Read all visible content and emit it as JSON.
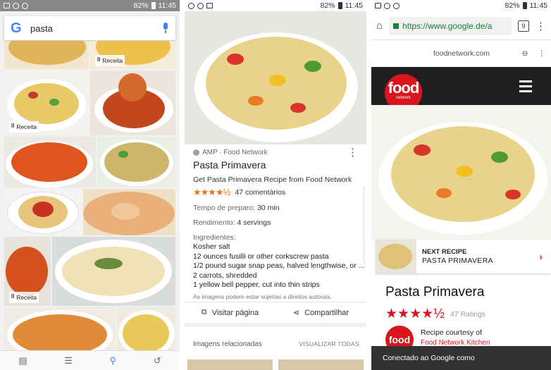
{
  "status": {
    "battery": "82%",
    "time": "11:45"
  },
  "panel1": {
    "google_logo": "G",
    "query": "pasta",
    "badges": {
      "receita": "Receita"
    },
    "nav_icons": [
      "feed-icon",
      "updates-icon",
      "search-icon",
      "history-icon"
    ]
  },
  "panel2": {
    "source": "AMP · Food Network",
    "title": "Pasta Primavera",
    "subtitle": "Get Pasta Primavera Recipe from Food Network",
    "stars": "★★★★½",
    "comments": "47 comentários",
    "prep_label": "Tempo de preparo:",
    "prep_value": "30 min",
    "yield_label": "Rendimento:",
    "yield_value": "4 servings",
    "ingredients_label": "Ingredientes:",
    "ingredients": [
      "Kosher salt",
      "12 ounces fusilli or other corkscrew pasta",
      "1/2 pound sugar snap peas, halved lengthwise, or ...",
      "2 carrots, shredded",
      "1 yellow bell pepper, cut into thin strips"
    ],
    "disclaimer": "As imagens podem estar sujeitas a direitos autorais.",
    "visit_label": "Visitar página",
    "share_label": "Compartilhar",
    "related_label": "Imagens relacionadas",
    "view_all_label": "VISUALIZAR TODAS"
  },
  "panel3": {
    "url": "https://www.google.de/a",
    "tab_count": "9",
    "domain": "foodnetwork.com",
    "logo_text": "food",
    "logo_sub": "network",
    "next_recipe_label": "NEXT RECIPE",
    "next_recipe_name": "PASTA PRIMAVERA",
    "title": "Pasta Primavera",
    "stars": "★★★★½",
    "ratings": "47 Ratings",
    "courtesy_label": "Recipe courtesy of",
    "courtesy_name": "Food Network Kitchen",
    "snackbar": "Conectado ao Google como"
  },
  "colors": {
    "google_blue": "#4285f4",
    "star_orange": "#e8711c",
    "fn_red": "#d7161e"
  }
}
